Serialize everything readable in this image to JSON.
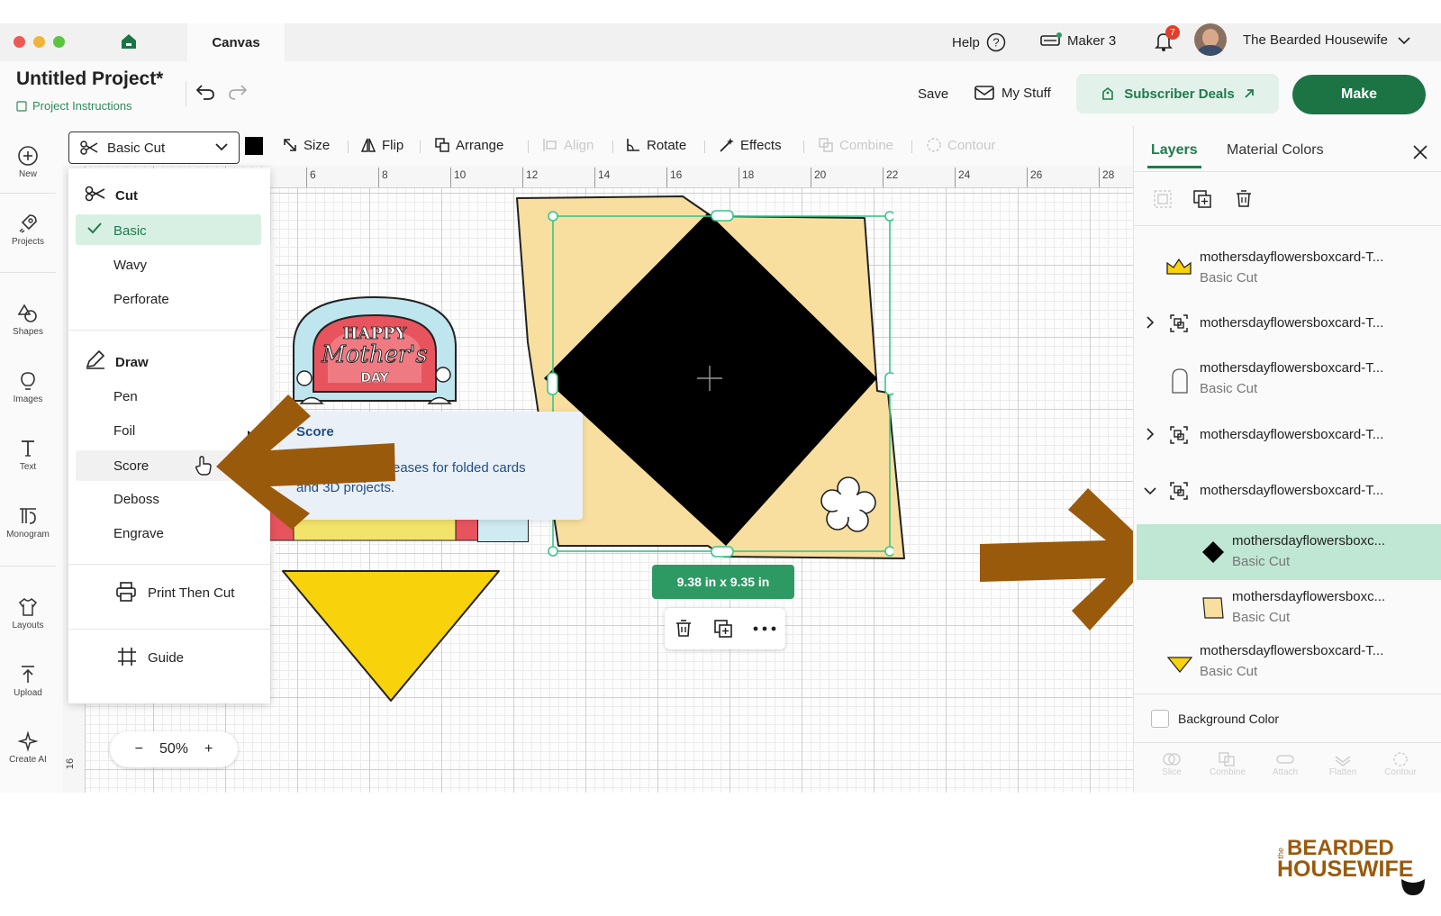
{
  "window": {
    "tab_title": "Canvas"
  },
  "topbar": {
    "help": "Help",
    "machine": "Maker 3",
    "notification_count": "7",
    "user_name": "The Bearded Housewife"
  },
  "header": {
    "project_title": "Untitled Project*",
    "project_instructions": "Project Instructions",
    "save": "Save",
    "my_stuff": "My Stuff",
    "subscriber_deals": "Subscriber Deals",
    "make": "Make"
  },
  "toolbar": {
    "operation": "Basic Cut",
    "tools": {
      "size": "Size",
      "flip": "Flip",
      "arrange": "Arrange",
      "align": "Align",
      "rotate": "Rotate",
      "effects": "Effects",
      "combine": "Combine",
      "contour": "Contour"
    }
  },
  "sidebar": {
    "new": "New",
    "projects": "Projects",
    "shapes": "Shapes",
    "images": "Images",
    "text": "Text",
    "monogram": "Monogram",
    "layouts": "Layouts",
    "upload": "Upload",
    "create_ai": "Create AI"
  },
  "ruler": {
    "top": [
      "6",
      "8",
      "10",
      "12",
      "14",
      "16",
      "18",
      "20",
      "22",
      "24",
      "26",
      "28"
    ],
    "left": "16"
  },
  "operation_menu": {
    "cut_header": "Cut",
    "cut_items": {
      "basic": "Basic",
      "wavy": "Wavy",
      "perforate": "Perforate"
    },
    "draw_header": "Draw",
    "draw_items": {
      "pen": "Pen",
      "foil": "Foil",
      "score": "Score",
      "deboss": "Deboss",
      "engrave": "Engrave"
    },
    "print_then_cut": "Print Then Cut",
    "guide": "Guide",
    "selected": "Basic",
    "hovered": "Score"
  },
  "tooltip": {
    "title": "Score",
    "body_line1": "reases for folded cards",
    "body_line2": "and 3D projects."
  },
  "canvas_objects": {
    "badge_text": {
      "happy": "HAPPY",
      "mothers": "Mother's",
      "day": "DAY"
    }
  },
  "selection": {
    "size_label": "9.38  in x 9.35  in"
  },
  "zoom": {
    "minus": "−",
    "value": "50%",
    "plus": "+"
  },
  "right_panel": {
    "tabs": {
      "layers": "Layers",
      "material_colors": "Material Colors"
    },
    "layers": [
      {
        "name": "mothersdayflowersboxcard-T...",
        "sub": "Basic Cut"
      },
      {
        "name": "mothersdayflowersboxcard-T...",
        "sub": ""
      },
      {
        "name": "mothersdayflowersboxcard-T...",
        "sub": "Basic Cut"
      },
      {
        "name": "mothersdayflowersboxcard-T...",
        "sub": ""
      },
      {
        "name": "mothersdayflowersboxcard-T...",
        "sub": ""
      },
      {
        "name": "mothersdayflowersboxc...",
        "sub": "Basic Cut"
      },
      {
        "name": "mothersdayflowersboxc...",
        "sub": "Basic Cut"
      },
      {
        "name": "mothersdayflowersboxcard-T...",
        "sub": "Basic Cut"
      }
    ],
    "background_color": "Background Color",
    "bottom_actions": {
      "slice": "Slice",
      "combine": "Combine",
      "attach": "Attach",
      "flatten": "Flatten",
      "contour": "Contour"
    }
  },
  "watermark": {
    "small": "the",
    "line1": "BEARDED",
    "line2": "HOUSEWIFE"
  },
  "colors": {
    "accent_green": "#1c7445",
    "selected_row": "#bfe7d3",
    "arrow": "#9a5a0c",
    "card_tan": "#f7dfa0",
    "diamond": "#000000"
  }
}
